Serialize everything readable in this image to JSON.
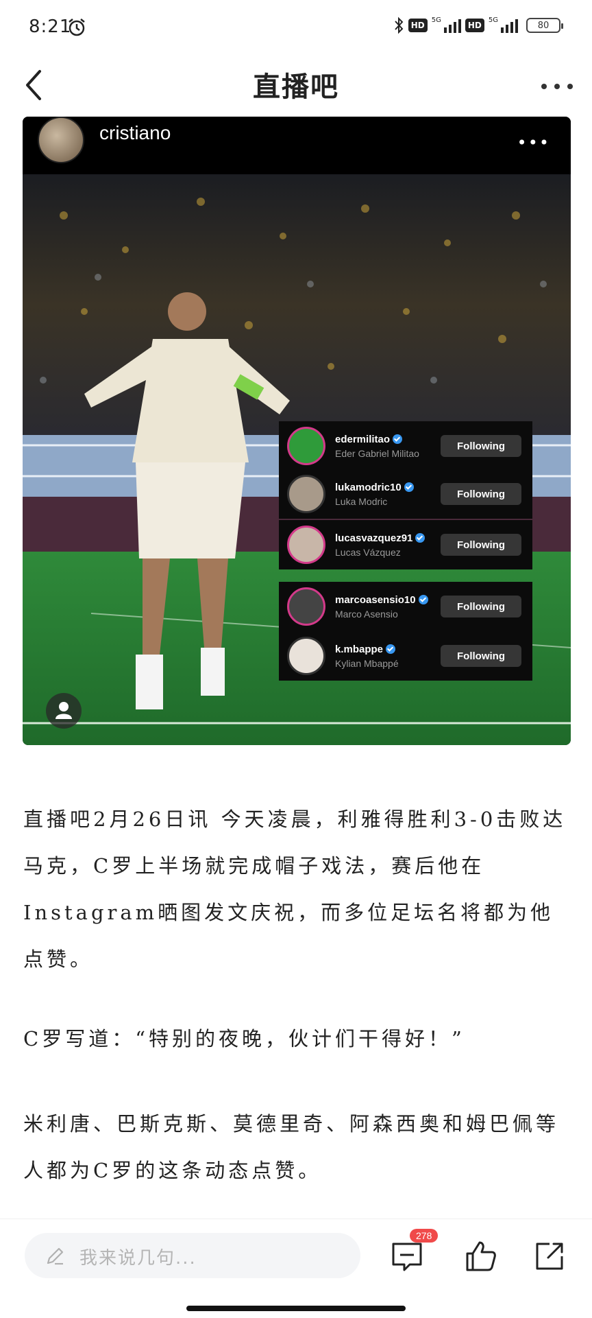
{
  "status_bar": {
    "time": "8:21",
    "hd1": "HD",
    "g1": "5G",
    "hd2": "HD",
    "g2": "5G",
    "battery": "80"
  },
  "nav": {
    "title": "直播吧"
  },
  "post": {
    "username": "cristiano",
    "following": [
      {
        "user": "edermilitao",
        "name": "Eder Gabriel Militao",
        "button": "Following",
        "avatar_color": "#2f9b3a"
      },
      {
        "user": "lukamodric10",
        "name": "Luka Modric",
        "button": "Following",
        "avatar_color": "#a89a8a"
      },
      {
        "user": "lucasvazquez91",
        "name": "Lucas Vázquez",
        "button": "Following",
        "avatar_color": "#c8b6a8"
      },
      {
        "user": "marcoasensio10",
        "name": "Marco Asensio",
        "button": "Following",
        "avatar_color": "#444444"
      },
      {
        "user": "k.mbappe",
        "name": "Kylian Mbappé",
        "button": "Following",
        "avatar_color": "#e9e2da"
      }
    ]
  },
  "article": {
    "p1": "直播吧2月26日讯 今天凌晨，利雅得胜利3-0击败达马克，C罗上半场就完成帽子戏法，赛后他在Instagram晒图发文庆祝，而多位足坛名将都为他点赞。",
    "p2": "C罗写道：“特别的夜晚，伙计们干得好！”",
    "p3": "米利唐、巴斯克斯、莫德里奇、阿森西奥和姆巴佩等人都为C罗的这条动态点赞。"
  },
  "bottom": {
    "placeholder": "我来说几句...",
    "comment_count": "278"
  }
}
